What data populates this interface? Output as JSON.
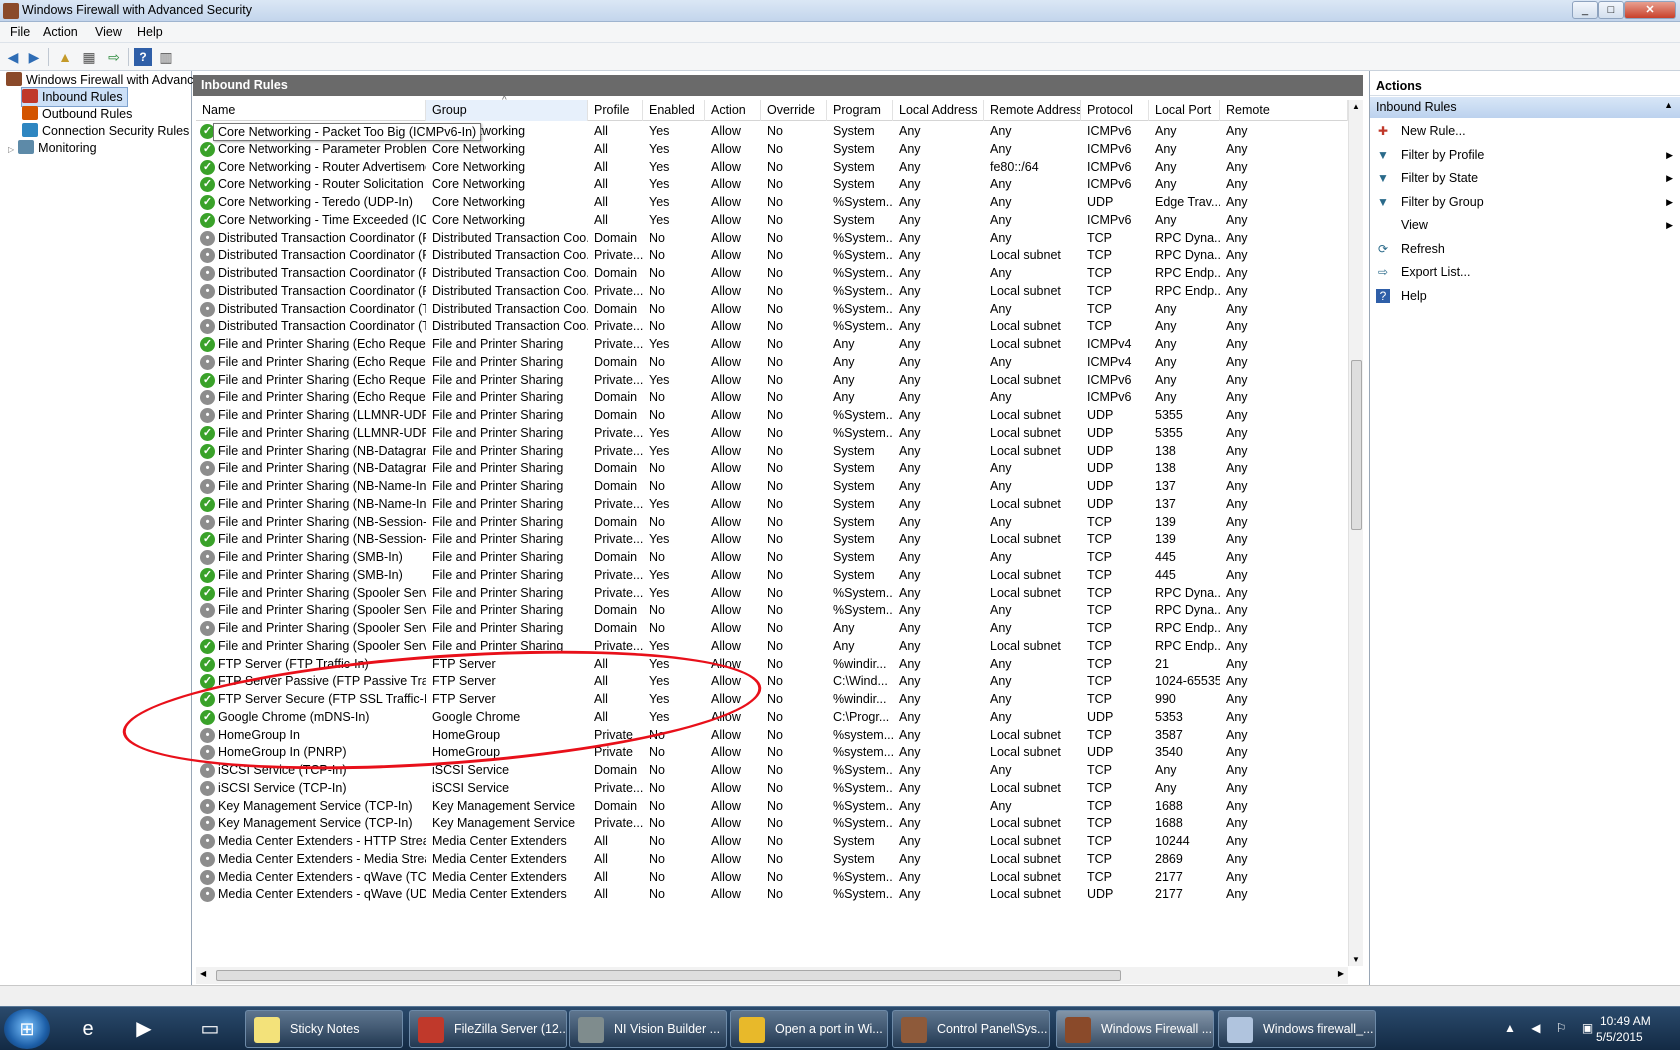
{
  "window": {
    "title": "Windows Firewall with Advanced Security"
  },
  "menu": [
    "File",
    "Action",
    "View",
    "Help"
  ],
  "tree": {
    "root": "Windows Firewall with Advance",
    "items": [
      "Inbound Rules",
      "Outbound Rules",
      "Connection Security Rules",
      "Monitoring"
    ]
  },
  "center": {
    "title": "Inbound Rules",
    "columns": [
      "Name",
      "Group",
      "Profile",
      "Enabled",
      "Action",
      "Override",
      "Program",
      "Local Address",
      "Remote Address",
      "Protocol",
      "Local Port",
      "Remote"
    ],
    "tooltip": "Core Networking - Packet Too Big (ICMPv6-In)",
    "rows": [
      [
        "on",
        "Core Networking - Packet Too Big (ICMPv6-In)",
        "Core Networking",
        "All",
        "Yes",
        "Allow",
        "No",
        "System",
        "Any",
        "Any",
        "ICMPv6",
        "Any",
        "Any"
      ],
      [
        "on",
        "Core Networking - Parameter Problem (I...",
        "Core Networking",
        "All",
        "Yes",
        "Allow",
        "No",
        "System",
        "Any",
        "Any",
        "ICMPv6",
        "Any",
        "Any"
      ],
      [
        "on",
        "Core Networking - Router Advertisement...",
        "Core Networking",
        "All",
        "Yes",
        "Allow",
        "No",
        "System",
        "Any",
        "fe80::/64",
        "ICMPv6",
        "Any",
        "Any"
      ],
      [
        "on",
        "Core Networking - Router Solicitation (IC...",
        "Core Networking",
        "All",
        "Yes",
        "Allow",
        "No",
        "System",
        "Any",
        "Any",
        "ICMPv6",
        "Any",
        "Any"
      ],
      [
        "on",
        "Core Networking - Teredo (UDP-In)",
        "Core Networking",
        "All",
        "Yes",
        "Allow",
        "No",
        "%System...",
        "Any",
        "Any",
        "UDP",
        "Edge Trav...",
        "Any"
      ],
      [
        "on",
        "Core Networking - Time Exceeded (ICMP...",
        "Core Networking",
        "All",
        "Yes",
        "Allow",
        "No",
        "System",
        "Any",
        "Any",
        "ICMPv6",
        "Any",
        "Any"
      ],
      [
        "off",
        "Distributed Transaction Coordinator (RPC)",
        "Distributed Transaction Coo...",
        "Domain",
        "No",
        "Allow",
        "No",
        "%System...",
        "Any",
        "Any",
        "TCP",
        "RPC Dyna...",
        "Any"
      ],
      [
        "off",
        "Distributed Transaction Coordinator (RPC)",
        "Distributed Transaction Coo...",
        "Private...",
        "No",
        "Allow",
        "No",
        "%System...",
        "Any",
        "Local subnet",
        "TCP",
        "RPC Dyna...",
        "Any"
      ],
      [
        "off",
        "Distributed Transaction Coordinator (RP...",
        "Distributed Transaction Coo...",
        "Domain",
        "No",
        "Allow",
        "No",
        "%System...",
        "Any",
        "Any",
        "TCP",
        "RPC Endp...",
        "Any"
      ],
      [
        "off",
        "Distributed Transaction Coordinator (RP...",
        "Distributed Transaction Coo...",
        "Private...",
        "No",
        "Allow",
        "No",
        "%System...",
        "Any",
        "Local subnet",
        "TCP",
        "RPC Endp...",
        "Any"
      ],
      [
        "off",
        "Distributed Transaction Coordinator (TC...",
        "Distributed Transaction Coo...",
        "Domain",
        "No",
        "Allow",
        "No",
        "%System...",
        "Any",
        "Any",
        "TCP",
        "Any",
        "Any"
      ],
      [
        "off",
        "Distributed Transaction Coordinator (TC...",
        "Distributed Transaction Coo...",
        "Private...",
        "No",
        "Allow",
        "No",
        "%System...",
        "Any",
        "Local subnet",
        "TCP",
        "Any",
        "Any"
      ],
      [
        "on",
        "File and Printer Sharing (Echo Request - I...",
        "File and Printer Sharing",
        "Private...",
        "Yes",
        "Allow",
        "No",
        "Any",
        "Any",
        "Local subnet",
        "ICMPv4",
        "Any",
        "Any"
      ],
      [
        "off",
        "File and Printer Sharing (Echo Request - I...",
        "File and Printer Sharing",
        "Domain",
        "No",
        "Allow",
        "No",
        "Any",
        "Any",
        "Any",
        "ICMPv4",
        "Any",
        "Any"
      ],
      [
        "on",
        "File and Printer Sharing (Echo Request - I...",
        "File and Printer Sharing",
        "Private...",
        "Yes",
        "Allow",
        "No",
        "Any",
        "Any",
        "Local subnet",
        "ICMPv6",
        "Any",
        "Any"
      ],
      [
        "off",
        "File and Printer Sharing (Echo Request - I...",
        "File and Printer Sharing",
        "Domain",
        "No",
        "Allow",
        "No",
        "Any",
        "Any",
        "Any",
        "ICMPv6",
        "Any",
        "Any"
      ],
      [
        "off",
        "File and Printer Sharing (LLMNR-UDP-In)",
        "File and Printer Sharing",
        "Domain",
        "No",
        "Allow",
        "No",
        "%System...",
        "Any",
        "Local subnet",
        "UDP",
        "5355",
        "Any"
      ],
      [
        "on",
        "File and Printer Sharing (LLMNR-UDP-In)",
        "File and Printer Sharing",
        "Private...",
        "Yes",
        "Allow",
        "No",
        "%System...",
        "Any",
        "Local subnet",
        "UDP",
        "5355",
        "Any"
      ],
      [
        "on",
        "File and Printer Sharing (NB-Datagram-In)",
        "File and Printer Sharing",
        "Private...",
        "Yes",
        "Allow",
        "No",
        "System",
        "Any",
        "Local subnet",
        "UDP",
        "138",
        "Any"
      ],
      [
        "off",
        "File and Printer Sharing (NB-Datagram-In)",
        "File and Printer Sharing",
        "Domain",
        "No",
        "Allow",
        "No",
        "System",
        "Any",
        "Any",
        "UDP",
        "138",
        "Any"
      ],
      [
        "off",
        "File and Printer Sharing (NB-Name-In)",
        "File and Printer Sharing",
        "Domain",
        "No",
        "Allow",
        "No",
        "System",
        "Any",
        "Any",
        "UDP",
        "137",
        "Any"
      ],
      [
        "on",
        "File and Printer Sharing (NB-Name-In)",
        "File and Printer Sharing",
        "Private...",
        "Yes",
        "Allow",
        "No",
        "System",
        "Any",
        "Local subnet",
        "UDP",
        "137",
        "Any"
      ],
      [
        "off",
        "File and Printer Sharing (NB-Session-In)",
        "File and Printer Sharing",
        "Domain",
        "No",
        "Allow",
        "No",
        "System",
        "Any",
        "Any",
        "TCP",
        "139",
        "Any"
      ],
      [
        "on",
        "File and Printer Sharing (NB-Session-In)",
        "File and Printer Sharing",
        "Private...",
        "Yes",
        "Allow",
        "No",
        "System",
        "Any",
        "Local subnet",
        "TCP",
        "139",
        "Any"
      ],
      [
        "off",
        "File and Printer Sharing (SMB-In)",
        "File and Printer Sharing",
        "Domain",
        "No",
        "Allow",
        "No",
        "System",
        "Any",
        "Any",
        "TCP",
        "445",
        "Any"
      ],
      [
        "on",
        "File and Printer Sharing (SMB-In)",
        "File and Printer Sharing",
        "Private...",
        "Yes",
        "Allow",
        "No",
        "System",
        "Any",
        "Local subnet",
        "TCP",
        "445",
        "Any"
      ],
      [
        "on",
        "File and Printer Sharing (Spooler Service -...",
        "File and Printer Sharing",
        "Private...",
        "Yes",
        "Allow",
        "No",
        "%System...",
        "Any",
        "Local subnet",
        "TCP",
        "RPC Dyna...",
        "Any"
      ],
      [
        "off",
        "File and Printer Sharing (Spooler Service -...",
        "File and Printer Sharing",
        "Domain",
        "No",
        "Allow",
        "No",
        "%System...",
        "Any",
        "Any",
        "TCP",
        "RPC Dyna...",
        "Any"
      ],
      [
        "off",
        "File and Printer Sharing (Spooler Service -...",
        "File and Printer Sharing",
        "Domain",
        "No",
        "Allow",
        "No",
        "Any",
        "Any",
        "Any",
        "TCP",
        "RPC Endp...",
        "Any"
      ],
      [
        "on",
        "File and Printer Sharing (Spooler Service -...",
        "File and Printer Sharing",
        "Private...",
        "Yes",
        "Allow",
        "No",
        "Any",
        "Any",
        "Local subnet",
        "TCP",
        "RPC Endp...",
        "Any"
      ],
      [
        "on",
        "FTP Server (FTP Traffic-In)",
        "FTP Server",
        "All",
        "Yes",
        "Allow",
        "No",
        "%windir...",
        "Any",
        "Any",
        "TCP",
        "21",
        "Any"
      ],
      [
        "on",
        "FTP Server Passive (FTP Passive Traffic-In)",
        "FTP Server",
        "All",
        "Yes",
        "Allow",
        "No",
        "C:\\Wind...",
        "Any",
        "Any",
        "TCP",
        "1024-65535",
        "Any"
      ],
      [
        "on",
        "FTP Server Secure (FTP SSL Traffic-In)",
        "FTP Server",
        "All",
        "Yes",
        "Allow",
        "No",
        "%windir...",
        "Any",
        "Any",
        "TCP",
        "990",
        "Any"
      ],
      [
        "on",
        "Google Chrome (mDNS-In)",
        "Google Chrome",
        "All",
        "Yes",
        "Allow",
        "No",
        "C:\\Progr...",
        "Any",
        "Any",
        "UDP",
        "5353",
        "Any"
      ],
      [
        "off",
        "HomeGroup In",
        "HomeGroup",
        "Private",
        "No",
        "Allow",
        "No",
        "%system...",
        "Any",
        "Local subnet",
        "TCP",
        "3587",
        "Any"
      ],
      [
        "off",
        "HomeGroup In (PNRP)",
        "HomeGroup",
        "Private",
        "No",
        "Allow",
        "No",
        "%system...",
        "Any",
        "Local subnet",
        "UDP",
        "3540",
        "Any"
      ],
      [
        "off",
        "iSCSI Service (TCP-In)",
        "iSCSI Service",
        "Domain",
        "No",
        "Allow",
        "No",
        "%System...",
        "Any",
        "Any",
        "TCP",
        "Any",
        "Any"
      ],
      [
        "off",
        "iSCSI Service (TCP-In)",
        "iSCSI Service",
        "Private...",
        "No",
        "Allow",
        "No",
        "%System...",
        "Any",
        "Local subnet",
        "TCP",
        "Any",
        "Any"
      ],
      [
        "off",
        "Key Management Service (TCP-In)",
        "Key Management Service",
        "Domain",
        "No",
        "Allow",
        "No",
        "%System...",
        "Any",
        "Any",
        "TCP",
        "1688",
        "Any"
      ],
      [
        "off",
        "Key Management Service (TCP-In)",
        "Key Management Service",
        "Private...",
        "No",
        "Allow",
        "No",
        "%System...",
        "Any",
        "Local subnet",
        "TCP",
        "1688",
        "Any"
      ],
      [
        "off",
        "Media Center Extenders - HTTP Streamin...",
        "Media Center Extenders",
        "All",
        "No",
        "Allow",
        "No",
        "System",
        "Any",
        "Local subnet",
        "TCP",
        "10244",
        "Any"
      ],
      [
        "off",
        "Media Center Extenders - Media Streami...",
        "Media Center Extenders",
        "All",
        "No",
        "Allow",
        "No",
        "System",
        "Any",
        "Local subnet",
        "TCP",
        "2869",
        "Any"
      ],
      [
        "off",
        "Media Center Extenders - qWave (TCP-In)",
        "Media Center Extenders",
        "All",
        "No",
        "Allow",
        "No",
        "%System...",
        "Any",
        "Local subnet",
        "TCP",
        "2177",
        "Any"
      ],
      [
        "off",
        "Media Center Extenders - qWave (UDP-In)",
        "Media Center Extenders",
        "All",
        "No",
        "Allow",
        "No",
        "%System...",
        "Any",
        "Local subnet",
        "UDP",
        "2177",
        "Any"
      ]
    ]
  },
  "actions": {
    "title": "Actions",
    "section": "Inbound Rules",
    "items": [
      {
        "label": "New Rule...",
        "icon": "new-rule-icon",
        "submenu": false
      },
      {
        "label": "Filter by Profile",
        "icon": "filter-icon",
        "submenu": true
      },
      {
        "label": "Filter by State",
        "icon": "filter-icon",
        "submenu": true
      },
      {
        "label": "Filter by Group",
        "icon": "filter-icon",
        "submenu": true
      },
      {
        "label": "View",
        "icon": "",
        "submenu": true
      },
      {
        "label": "Refresh",
        "icon": "refresh-icon",
        "submenu": false
      },
      {
        "label": "Export List...",
        "icon": "export-icon",
        "submenu": false
      },
      {
        "label": "Help",
        "icon": "help-icon",
        "submenu": false
      }
    ]
  },
  "taskbar": {
    "items": [
      {
        "label": "Sticky Notes",
        "icon": "sticky-notes-icon",
        "color": "#f3e27a"
      },
      {
        "label": "FileZilla Server (12...",
        "icon": "filezilla-icon",
        "color": "#c0392b"
      },
      {
        "label": "NI Vision Builder ...",
        "icon": "vision-builder-icon",
        "color": "#7f8c8d"
      },
      {
        "label": "Open a port in Wi...",
        "icon": "chrome-icon",
        "color": "#e8b92a"
      },
      {
        "label": "Control Panel\\Sys...",
        "icon": "control-panel-icon",
        "color": "#8e5a3a"
      },
      {
        "label": "Windows Firewall ...",
        "icon": "firewall-icon",
        "color": "#8a4a2a"
      },
      {
        "label": "Windows firewall_...",
        "icon": "paint-icon",
        "color": "#b0c4de"
      }
    ],
    "time": "10:49 AM",
    "date": "5/5/2015"
  },
  "colors": {
    "enabled": "#3aa22a",
    "disabled": "#8d8d8d",
    "annotation": "#e8101a"
  }
}
